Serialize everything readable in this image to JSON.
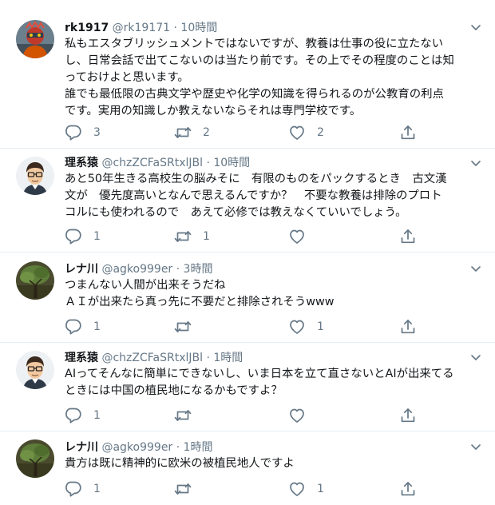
{
  "tweets": [
    {
      "name": "rk1917",
      "handle": "@rk19171",
      "dot": "·",
      "time": "10時間",
      "avatar": "avatar-red-figure",
      "lines": [
        "私もエスタブリッシュメントではないですが、教養は仕事の役に立たない",
        "し、日常会話で出てこないのは当たり前です。その上でその程度のことは知",
        "っておけよと思います。",
        "誰でも最低限の古典文学や歴史や化学の知識を得られるのが公教育の利点",
        "です。実用の知識しか教えないならそれは専門学校です。"
      ],
      "replies": "3",
      "retweets": "2",
      "likes": "2"
    },
    {
      "name": "理系猿",
      "handle": "@chzZCFaSRtxlJBl",
      "dot": "·",
      "time": "10時間",
      "avatar": "avatar-cartoon-man",
      "lines": [
        "あと50年生きる高校生の脳みそに　有限のものをパックするとき　古文漢",
        "文が　優先度高いとなんで思えるんですか？　不要な教養は排除のプロト",
        "コルにも使われるので　あえて必修では教えなくていいでしょう。"
      ],
      "replies": "1",
      "retweets": "1",
      "likes": ""
    },
    {
      "name": "レナ川",
      "handle": "@agko999er",
      "dot": "·",
      "time": "3時間",
      "avatar": "avatar-tree",
      "lines": [
        "つまんない人間が出来そうだね",
        "ＡＩが出来たら真っ先に不要だと排除されそうwww"
      ],
      "replies": "1",
      "retweets": "",
      "likes": "1"
    },
    {
      "name": "理系猿",
      "handle": "@chzZCFaSRtxlJBl",
      "dot": "·",
      "time": "1時間",
      "avatar": "avatar-cartoon-man",
      "lines": [
        "AIってそんなに簡単にできないし、いま日本を立て直さないとAIが出来てる",
        "ときには中国の植民地になるかもですよ？"
      ],
      "replies": "1",
      "retweets": "",
      "likes": ""
    },
    {
      "name": "レナ川",
      "handle": "@agko999er",
      "dot": "·",
      "time": "1時間",
      "avatar": "avatar-tree",
      "lines": [
        "貴方は既に精神的に欧米の被植民地人ですよ"
      ],
      "replies": "1",
      "retweets": "",
      "likes": "1"
    }
  ],
  "colors": {
    "text": "#14171a",
    "muted": "#657786",
    "divider": "#e6ecf0"
  }
}
